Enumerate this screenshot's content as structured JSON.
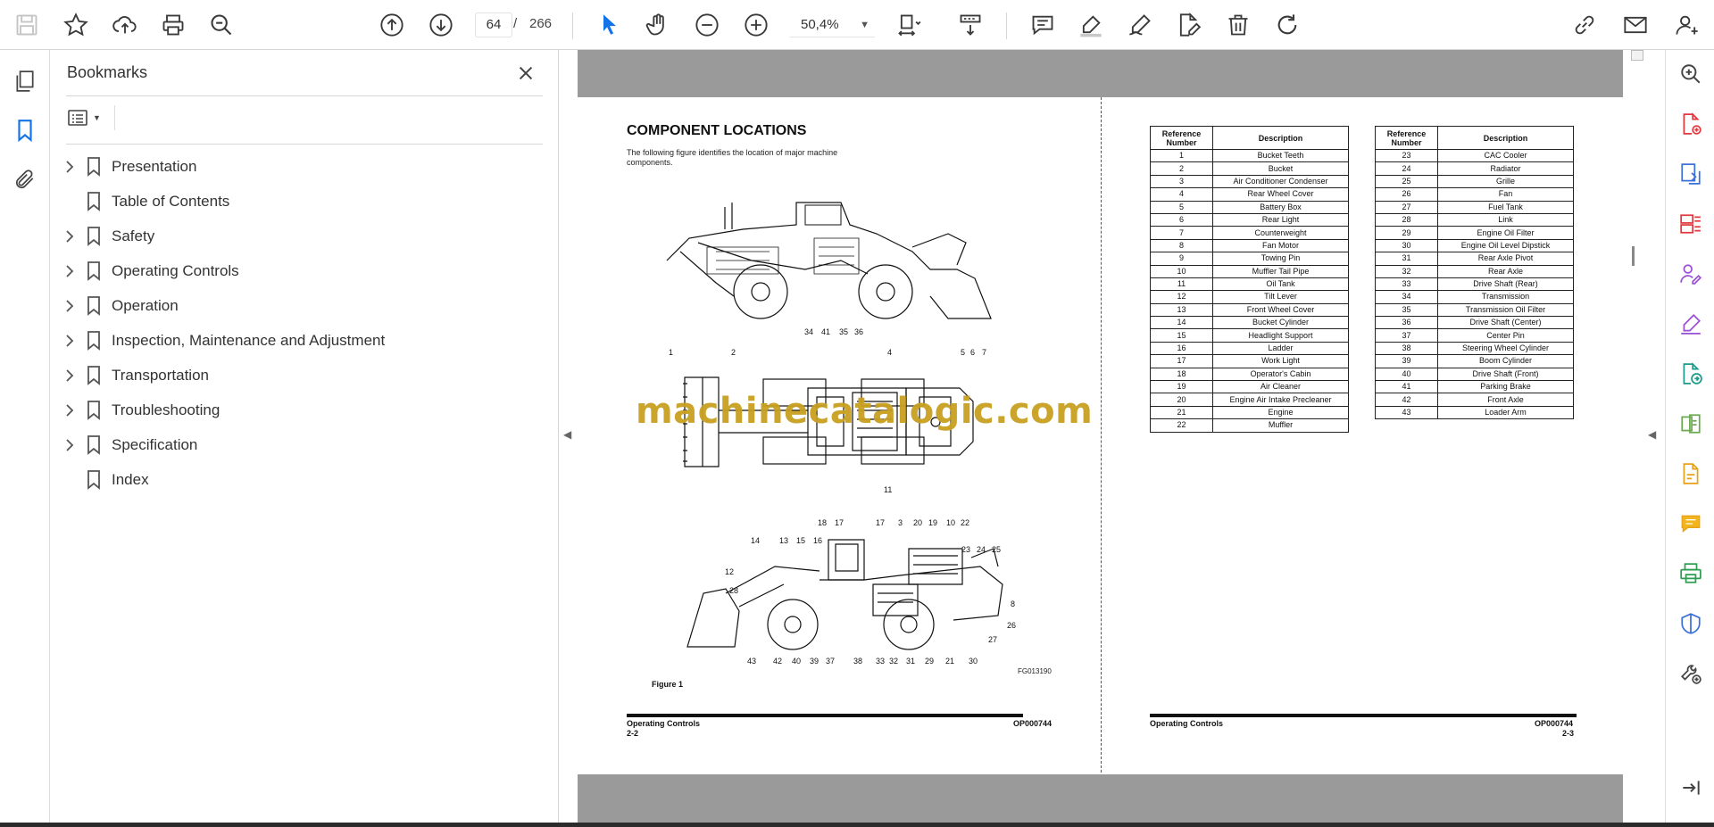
{
  "toolbar": {
    "current_page": "64",
    "page_separator": "/",
    "total_pages": "266",
    "zoom": "50,4%",
    "icons": [
      "save-icon",
      "bookmark-star-icon",
      "upload-icon",
      "print-icon",
      "find-zoom-icon",
      "prev-page-icon",
      "next-page-icon",
      "zoom-out-icon",
      "zoom-in-icon",
      "select-cursor-icon",
      "hand-tool-icon",
      "fit-page-icon",
      "scroll-mode-icon",
      "comment-icon",
      "highlight-icon",
      "draw-icon",
      "edit-pdf-icon",
      "delete-icon",
      "rotate-icon",
      "share-link-icon",
      "email-icon",
      "account-icon"
    ]
  },
  "bookmarks": {
    "title": "Bookmarks",
    "items": [
      {
        "label": "Presentation",
        "expandable": true
      },
      {
        "label": "Table of Contents",
        "expandable": false
      },
      {
        "label": "Safety",
        "expandable": true
      },
      {
        "label": "Operating Controls",
        "expandable": true
      },
      {
        "label": "Operation",
        "expandable": true
      },
      {
        "label": "Inspection, Maintenance and Adjustment",
        "expandable": true
      },
      {
        "label": "Transportation",
        "expandable": true
      },
      {
        "label": "Troubleshooting",
        "expandable": true
      },
      {
        "label": "Specification",
        "expandable": true
      },
      {
        "label": "Index",
        "expandable": false
      }
    ]
  },
  "left_page": {
    "title": "COMPONENT LOCATIONS",
    "intro": "The following figure identifies the location of major machine components.",
    "figure_code": "FG013190",
    "figure_caption": "Figure 1",
    "footer_section": "Operating Controls",
    "footer_code": "OP000744",
    "page_number": "2-2",
    "callouts_top": [
      "34",
      "41",
      "35",
      "36"
    ],
    "callouts_mid_top": [
      "1",
      "2",
      "4",
      "5",
      "6",
      "7"
    ],
    "callouts_mid_bottom": [
      "11"
    ],
    "callouts_bottom_top": [
      "18",
      "17",
      "17",
      "3",
      "20",
      "19",
      "10",
      "22"
    ],
    "callouts_bottom_left": [
      "14",
      "13",
      "15",
      "16",
      "12",
      "28",
      "23",
      "24",
      "25"
    ],
    "callouts_bottom_right": [
      "8",
      "26",
      "27"
    ],
    "callouts_bottom_row": [
      "43",
      "42",
      "40",
      "39",
      "37",
      "38",
      "33",
      "32",
      "31",
      "29",
      "21",
      "30"
    ]
  },
  "watermark": "machinecatalogic.com",
  "right_page": {
    "footer_section": "Operating Controls",
    "footer_code": "OP000744",
    "page_number": "2-3",
    "header_ref": "Reference Number",
    "header_desc": "Description",
    "table1": [
      [
        "1",
        "Bucket Teeth"
      ],
      [
        "2",
        "Bucket"
      ],
      [
        "3",
        "Air Conditioner Condenser"
      ],
      [
        "4",
        "Rear Wheel Cover"
      ],
      [
        "5",
        "Battery Box"
      ],
      [
        "6",
        "Rear Light"
      ],
      [
        "7",
        "Counterweight"
      ],
      [
        "8",
        "Fan Motor"
      ],
      [
        "9",
        "Towing Pin"
      ],
      [
        "10",
        "Muffler Tail Pipe"
      ],
      [
        "11",
        "Oil Tank"
      ],
      [
        "12",
        "Tilt Lever"
      ],
      [
        "13",
        "Front Wheel Cover"
      ],
      [
        "14",
        "Bucket Cylinder"
      ],
      [
        "15",
        "Headlight Support"
      ],
      [
        "16",
        "Ladder"
      ],
      [
        "17",
        "Work Light"
      ],
      [
        "18",
        "Operator's Cabin"
      ],
      [
        "19",
        "Air Cleaner"
      ],
      [
        "20",
        "Engine Air Intake Precleaner"
      ],
      [
        "21",
        "Engine"
      ],
      [
        "22",
        "Muffler"
      ]
    ],
    "table2": [
      [
        "23",
        "CAC Cooler"
      ],
      [
        "24",
        "Radiator"
      ],
      [
        "25",
        "Grille"
      ],
      [
        "26",
        "Fan"
      ],
      [
        "27",
        "Fuel Tank"
      ],
      [
        "28",
        "Link"
      ],
      [
        "29",
        "Engine Oil Filter"
      ],
      [
        "30",
        "Engine Oil Level Dipstick"
      ],
      [
        "31",
        "Rear Axle Pivot"
      ],
      [
        "32",
        "Rear Axle"
      ],
      [
        "33",
        "Drive Shaft (Rear)"
      ],
      [
        "34",
        "Transmission"
      ],
      [
        "35",
        "Transmission Oil Filter"
      ],
      [
        "36",
        "Drive Shaft (Center)"
      ],
      [
        "37",
        "Center Pin"
      ],
      [
        "38",
        "Steering Wheel Cylinder"
      ],
      [
        "39",
        "Boom Cylinder"
      ],
      [
        "40",
        "Drive Shaft (Front)"
      ],
      [
        "41",
        "Parking Brake"
      ],
      [
        "42",
        "Front Axle"
      ],
      [
        "43",
        "Loader Arm"
      ]
    ]
  },
  "right_rail_icons": [
    "zoom-panel-icon",
    "create-pdf-icon",
    "export-pdf-icon",
    "organize-pages-icon",
    "request-signature-icon",
    "fill-sign-icon",
    "send-review-icon",
    "compress-icon",
    "combine-icon",
    "comment-tool-icon",
    "print-production-icon",
    "protect-icon",
    "more-tools-icon",
    "expand-panel-icon"
  ],
  "colors": {
    "accent": "#1473e6",
    "watermark": "#c8a020"
  }
}
